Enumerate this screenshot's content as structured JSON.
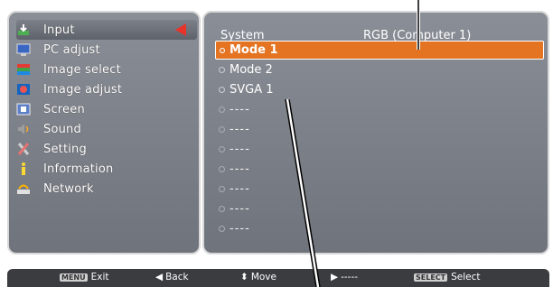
{
  "menu": {
    "items": [
      {
        "label": "Input",
        "icon": "input-icon",
        "selected": true
      },
      {
        "label": "PC adjust",
        "icon": "pc-adjust-icon",
        "selected": false
      },
      {
        "label": "Image select",
        "icon": "image-select-icon",
        "selected": false
      },
      {
        "label": "Image adjust",
        "icon": "image-adjust-icon",
        "selected": false
      },
      {
        "label": "Screen",
        "icon": "screen-icon",
        "selected": false
      },
      {
        "label": "Sound",
        "icon": "sound-icon",
        "selected": false
      },
      {
        "label": "Setting",
        "icon": "setting-icon",
        "selected": false
      },
      {
        "label": "Information",
        "icon": "information-icon",
        "selected": false
      },
      {
        "label": "Network",
        "icon": "network-icon",
        "selected": false
      }
    ]
  },
  "panel": {
    "title": "System",
    "source": "RGB (Computer 1)",
    "options": [
      {
        "label": "Mode 1",
        "selected": true
      },
      {
        "label": "Mode 2",
        "selected": false
      },
      {
        "label": "SVGA 1",
        "selected": false
      },
      {
        "label": "----",
        "selected": false
      },
      {
        "label": "----",
        "selected": false
      },
      {
        "label": "----",
        "selected": false
      },
      {
        "label": "----",
        "selected": false
      },
      {
        "label": "----",
        "selected": false
      },
      {
        "label": "----",
        "selected": false
      },
      {
        "label": "----",
        "selected": false
      }
    ]
  },
  "footer": {
    "exit_key": "MENU",
    "exit": "Exit",
    "back": "Back",
    "move": "Move",
    "next": "-----",
    "select_key": "SELECT",
    "select": "Select"
  },
  "colors": {
    "accent": "#e47422",
    "arrow": "#e8332a",
    "panel": "#7c8088"
  }
}
